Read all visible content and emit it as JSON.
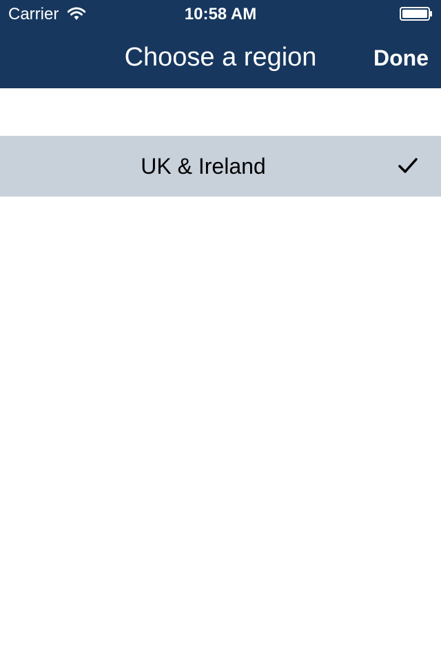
{
  "status_bar": {
    "carrier": "Carrier",
    "time": "10:58 AM",
    "wifi_icon": "wifi-icon",
    "battery_icon": "battery-icon"
  },
  "nav": {
    "title": "Choose a region",
    "done_label": "Done"
  },
  "regions": [
    {
      "label": "UK & Ireland",
      "selected": true,
      "icon": "checkmark-icon"
    }
  ],
  "colors": {
    "header_bg": "#17375e",
    "selected_row_bg": "#c8d0da",
    "header_text": "#ffffff"
  }
}
